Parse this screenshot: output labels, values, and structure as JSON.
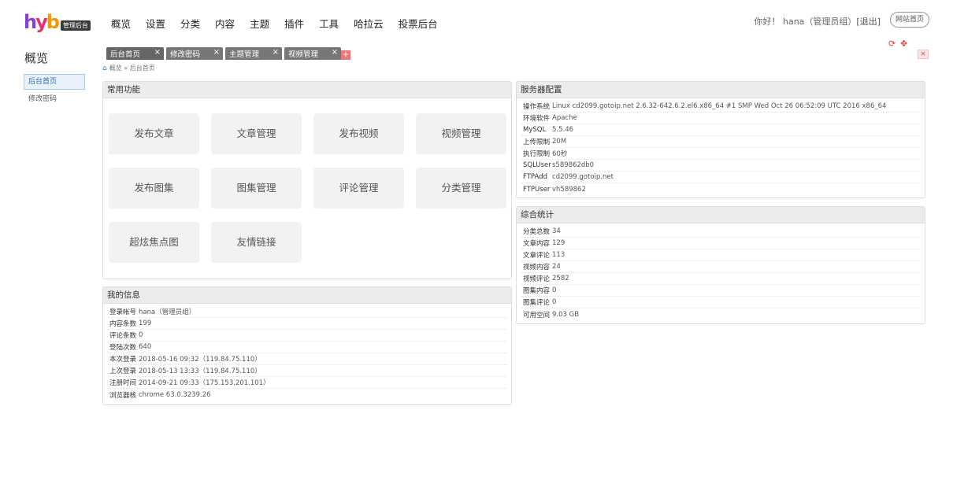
{
  "logo": {
    "mark": [
      "h",
      "y",
      "b"
    ],
    "badge": "管理后台"
  },
  "nav": [
    "概览",
    "设置",
    "分类",
    "内容",
    "主题",
    "插件",
    "工具",
    "哈拉云",
    "投票后台"
  ],
  "user": {
    "greeting": "你好！ hana（管理员组）",
    "logout": "[退出]",
    "site_button": "网站首页"
  },
  "sidebar": {
    "title": "概览",
    "items": [
      "后台首页",
      "修改密码"
    ]
  },
  "tabs": [
    {
      "label": "后台首页",
      "close": "×"
    },
    {
      "label": "修改密码",
      "close": "×"
    },
    {
      "label": "主题管理",
      "close": "×"
    },
    {
      "label": "视频管理",
      "close": "×"
    }
  ],
  "tab_add": "+",
  "tools": {
    "refresh": "⟳",
    "fullscreen": "✥",
    "close_all": "×"
  },
  "breadcrumb": "概览 » 后台首页",
  "common": {
    "title": "常用功能",
    "buttons": [
      "发布文章",
      "文章管理",
      "发布视频",
      "视频管理",
      "发布图集",
      "图集管理",
      "评论管理",
      "分类管理",
      "超炫焦点图",
      "友情链接"
    ]
  },
  "myinfo": {
    "title": "我的信息",
    "rows": [
      {
        "k": "登录帐号",
        "v": "hana（管理员组）"
      },
      {
        "k": "内容条数",
        "v": "199"
      },
      {
        "k": "评论条数",
        "v": "0"
      },
      {
        "k": "登陆次数",
        "v": "640"
      },
      {
        "k": "本次登录",
        "v": "2018-05-16 09:32（119.84.75.110）"
      },
      {
        "k": "上次登录",
        "v": "2018-05-13 13:33（119.84.75.110）"
      },
      {
        "k": "注册时间",
        "v": "2014-09-21 09:33（175.153.201.101）"
      },
      {
        "k": "浏览器核",
        "v": "chrome 63.0.3239.26"
      }
    ]
  },
  "server": {
    "title": "服务器配置",
    "rows": [
      {
        "k": "操作系统",
        "v": "Linux cd2099.gotoip.net 2.6.32-642.6.2.el6.x86_64 #1 SMP Wed Oct 26 06:52:09 UTC 2016 x86_64"
      },
      {
        "k": "环境软件",
        "v": "Apache"
      },
      {
        "k": "MySQL",
        "v": "5.5.46"
      },
      {
        "k": "上传限制",
        "v": "20M"
      },
      {
        "k": "执行限制",
        "v": "60秒"
      },
      {
        "k": "SQLUser",
        "v": "s589862db0"
      },
      {
        "k": "FTPAdd",
        "v": "cd2099.gotoip.net"
      },
      {
        "k": "FTPUser",
        "v": "vh589862"
      }
    ]
  },
  "stats": {
    "title": "综合统计",
    "rows": [
      {
        "k": "分类总数",
        "v": "34"
      },
      {
        "k": "文章内容",
        "v": "129"
      },
      {
        "k": "文章评论",
        "v": "113"
      },
      {
        "k": "视频内容",
        "v": "24"
      },
      {
        "k": "视频评论",
        "v": "2582"
      },
      {
        "k": "图集内容",
        "v": "0"
      },
      {
        "k": "图集评论",
        "v": "0"
      },
      {
        "k": "可用空间",
        "v": "9.03 GB"
      }
    ]
  }
}
